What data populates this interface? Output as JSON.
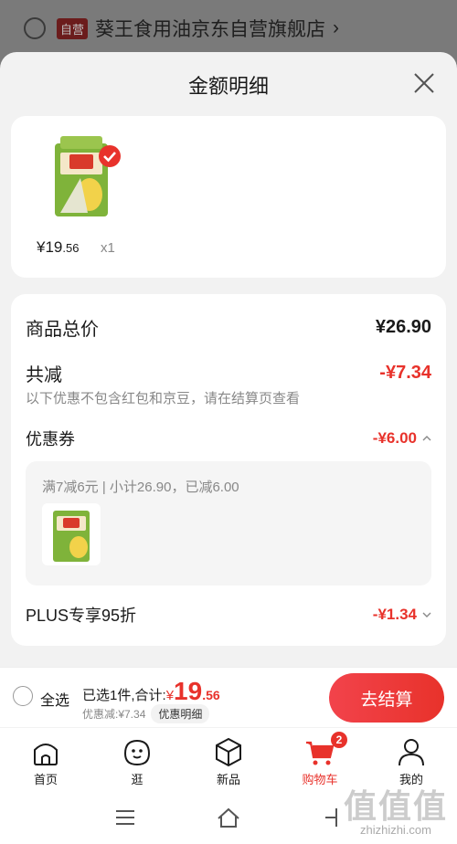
{
  "background_store": {
    "badge": "自营",
    "name": "葵王食用油京东自营旗舰店",
    "arrow": "›"
  },
  "sheet": {
    "title": "金额明细"
  },
  "product": {
    "price_main": "¥19",
    "price_cents": ".56",
    "quantity": "x1"
  },
  "detail": {
    "total_label": "商品总价",
    "total_value": "¥26.90",
    "reduction_label": "共减",
    "reduction_value": "-¥7.34",
    "note": "以下优惠不包含红包和京豆，请在结算页查看",
    "coupon_label": "优惠券",
    "coupon_value": "-¥6.00",
    "coupon_rule": "满7减6元 | 小计26.90，已减6.00",
    "plus_label": "PLUS专享95折",
    "plus_value": "-¥1.34"
  },
  "checkout": {
    "select_all": "全选",
    "summary_prefix": "已选1件,合计:",
    "currency": "¥",
    "total_main": "19",
    "total_cents": ".56",
    "discount_text": "优惠减:¥7.34",
    "detail_chip": "优惠明细",
    "checkout_button": "去结算"
  },
  "bottom_nav": {
    "items": [
      {
        "label": "首页",
        "icon": "home-icon"
      },
      {
        "label": "逛",
        "icon": "browse-face-icon"
      },
      {
        "label": "新品",
        "icon": "new-box-icon"
      },
      {
        "label": "购物车",
        "icon": "cart-icon",
        "badge": "2",
        "active": true
      },
      {
        "label": "我的",
        "icon": "profile-icon"
      }
    ]
  },
  "watermark": {
    "big": "值值值",
    "url": "zhizhizhi.com"
  },
  "colors": {
    "accent_red": "#e8322b",
    "sheet_bg": "#f2f2f2"
  }
}
